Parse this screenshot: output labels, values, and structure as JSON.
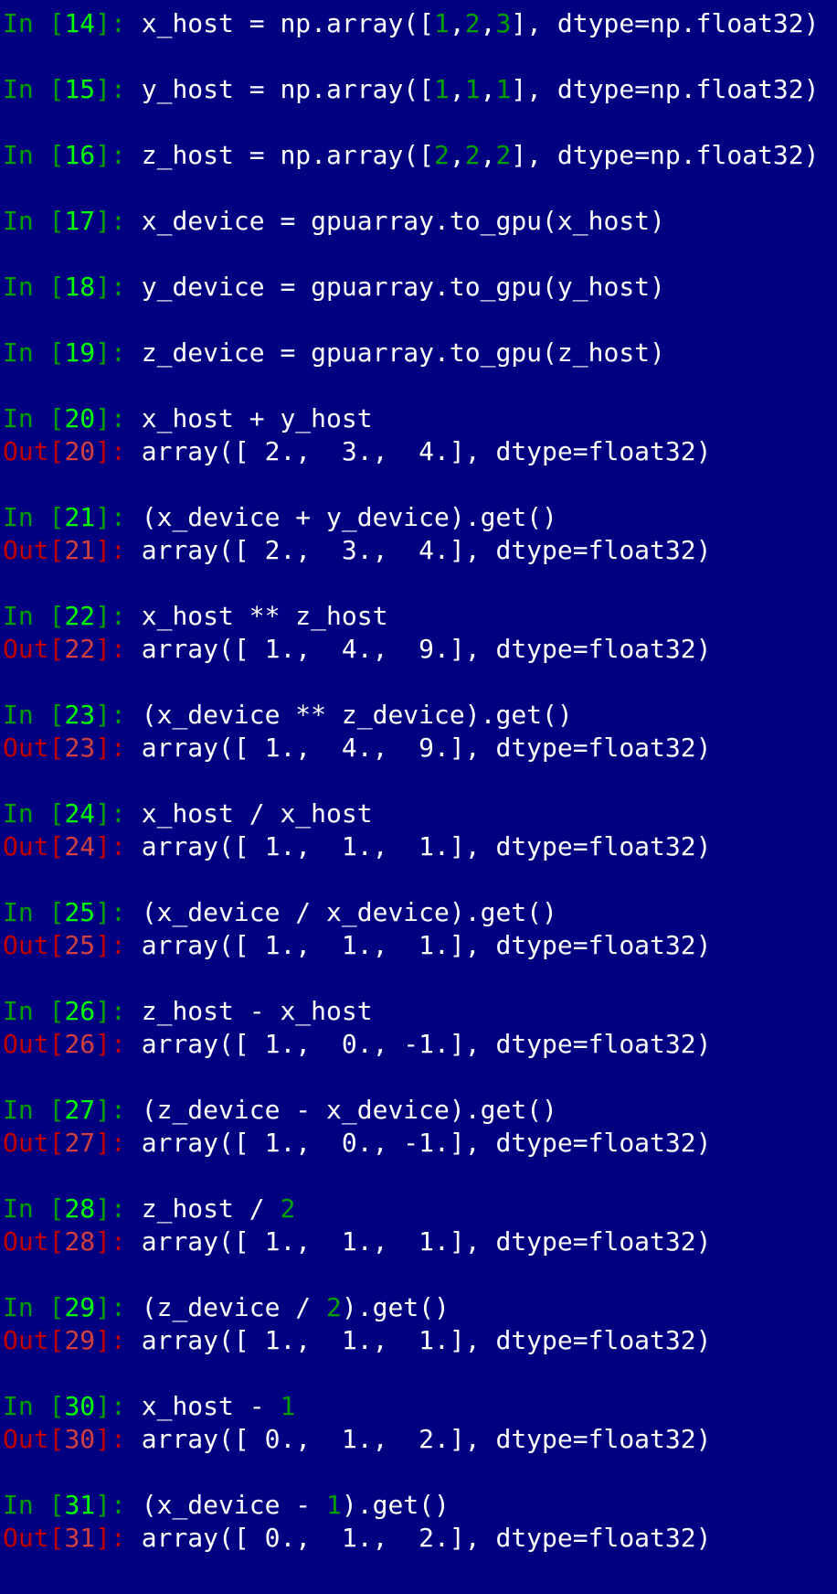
{
  "colors": {
    "background": "#000080",
    "text": "#ffffff",
    "in_prompt": "#00a000",
    "in_prompt_number": "#00ff00",
    "out_prompt": "#c00000",
    "literal_number": "#00a000"
  },
  "prompts": {
    "in": "In ",
    "out": "Out",
    "sep": ": "
  },
  "cells": [
    {
      "n": "14",
      "code": [
        "x_host = np.array([",
        {
          "num": "1"
        },
        ",",
        {
          "num": "2"
        },
        ",",
        {
          "num": "3"
        },
        "], dtype=np.float32)"
      ],
      "out": null
    },
    {
      "n": "15",
      "code": [
        "y_host = np.array([",
        {
          "num": "1"
        },
        ",",
        {
          "num": "1"
        },
        ",",
        {
          "num": "1"
        },
        "], dtype=np.float32)"
      ],
      "out": null
    },
    {
      "n": "16",
      "code": [
        "z_host = np.array([",
        {
          "num": "2"
        },
        ",",
        {
          "num": "2"
        },
        ",",
        {
          "num": "2"
        },
        "], dtype=np.float32)"
      ],
      "out": null
    },
    {
      "n": "17",
      "code": [
        "x_device = gpuarray.to_gpu(x_host)"
      ],
      "out": null
    },
    {
      "n": "18",
      "code": [
        "y_device = gpuarray.to_gpu(y_host)"
      ],
      "out": null
    },
    {
      "n": "19",
      "code": [
        "z_device = gpuarray.to_gpu(z_host)"
      ],
      "out": null
    },
    {
      "n": "20",
      "code": [
        "x_host + y_host"
      ],
      "out": "array([ 2.,  3.,  4.], dtype=float32)"
    },
    {
      "n": "21",
      "code": [
        "(x_device + y_device).get()"
      ],
      "out": "array([ 2.,  3.,  4.], dtype=float32)"
    },
    {
      "n": "22",
      "code": [
        "x_host ** z_host"
      ],
      "out": "array([ 1.,  4.,  9.], dtype=float32)"
    },
    {
      "n": "23",
      "code": [
        "(x_device ** z_device).get()"
      ],
      "out": "array([ 1.,  4.,  9.], dtype=float32)"
    },
    {
      "n": "24",
      "code": [
        "x_host / x_host"
      ],
      "out": "array([ 1.,  1.,  1.], dtype=float32)"
    },
    {
      "n": "25",
      "code": [
        "(x_device / x_device).get()"
      ],
      "out": "array([ 1.,  1.,  1.], dtype=float32)"
    },
    {
      "n": "26",
      "code": [
        "z_host - x_host"
      ],
      "out": "array([ 1.,  0., -1.], dtype=float32)"
    },
    {
      "n": "27",
      "code": [
        "(z_device - x_device).get()"
      ],
      "out": "array([ 1.,  0., -1.], dtype=float32)"
    },
    {
      "n": "28",
      "code": [
        "z_host / ",
        {
          "num": "2"
        }
      ],
      "out": "array([ 1.,  1.,  1.], dtype=float32)"
    },
    {
      "n": "29",
      "code": [
        "(z_device / ",
        {
          "num": "2"
        },
        ").get()"
      ],
      "out": "array([ 1.,  1.,  1.], dtype=float32)"
    },
    {
      "n": "30",
      "code": [
        "x_host - ",
        {
          "num": "1"
        }
      ],
      "out": "array([ 0.,  1.,  2.], dtype=float32)"
    },
    {
      "n": "31",
      "code": [
        "(x_device - ",
        {
          "num": "1"
        },
        ").get()"
      ],
      "out": "array([ 0.,  1.,  2.], dtype=float32)"
    }
  ]
}
